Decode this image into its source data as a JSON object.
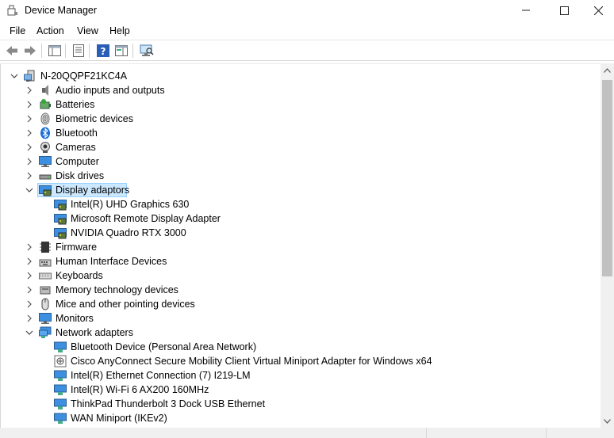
{
  "window": {
    "title": "Device Manager"
  },
  "menu": [
    "File",
    "Action",
    "View",
    "Help"
  ],
  "tree": {
    "root": "N-20QQPF21KC4A",
    "items": [
      {
        "label": "Audio inputs and outputs",
        "icon": "speaker-icon",
        "expanded": false
      },
      {
        "label": "Batteries",
        "icon": "battery-icon",
        "expanded": false
      },
      {
        "label": "Biometric devices",
        "icon": "fingerprint-icon",
        "expanded": false
      },
      {
        "label": "Bluetooth",
        "icon": "bluetooth-icon",
        "expanded": false
      },
      {
        "label": "Cameras",
        "icon": "camera-icon",
        "expanded": false
      },
      {
        "label": "Computer",
        "icon": "computer-icon",
        "expanded": false
      },
      {
        "label": "Disk drives",
        "icon": "disk-drive-icon",
        "expanded": false
      },
      {
        "label": "Display adaptors",
        "icon": "display-adapter-icon",
        "expanded": true,
        "selected": true,
        "children": [
          "Intel(R) UHD Graphics 630",
          "Microsoft Remote Display Adapter",
          "NVIDIA Quadro RTX 3000"
        ]
      },
      {
        "label": "Firmware",
        "icon": "firmware-icon",
        "expanded": false
      },
      {
        "label": "Human Interface Devices",
        "icon": "hid-icon",
        "expanded": false
      },
      {
        "label": "Keyboards",
        "icon": "keyboard-icon",
        "expanded": false
      },
      {
        "label": "Memory technology devices",
        "icon": "memory-icon",
        "expanded": false
      },
      {
        "label": "Mice and other pointing devices",
        "icon": "mouse-icon",
        "expanded": false
      },
      {
        "label": "Monitors",
        "icon": "monitor-icon",
        "expanded": false
      },
      {
        "label": "Network adapters",
        "icon": "network-adapter-icon",
        "expanded": true,
        "children": [
          "Bluetooth Device (Personal Area Network)",
          "Cisco AnyConnect Secure Mobility Client Virtual Miniport Adapter for Windows x64",
          "Intel(R) Ethernet Connection (7) I219-LM",
          "Intel(R) Wi-Fi 6 AX200 160MHz",
          "ThinkPad Thunderbolt 3 Dock USB Ethernet",
          "WAN Miniport (IKEv2)"
        ]
      }
    ]
  },
  "colors": {
    "selection": "#cce8ff",
    "selection_border": "#99d1ff",
    "accent": "#0078d7"
  }
}
